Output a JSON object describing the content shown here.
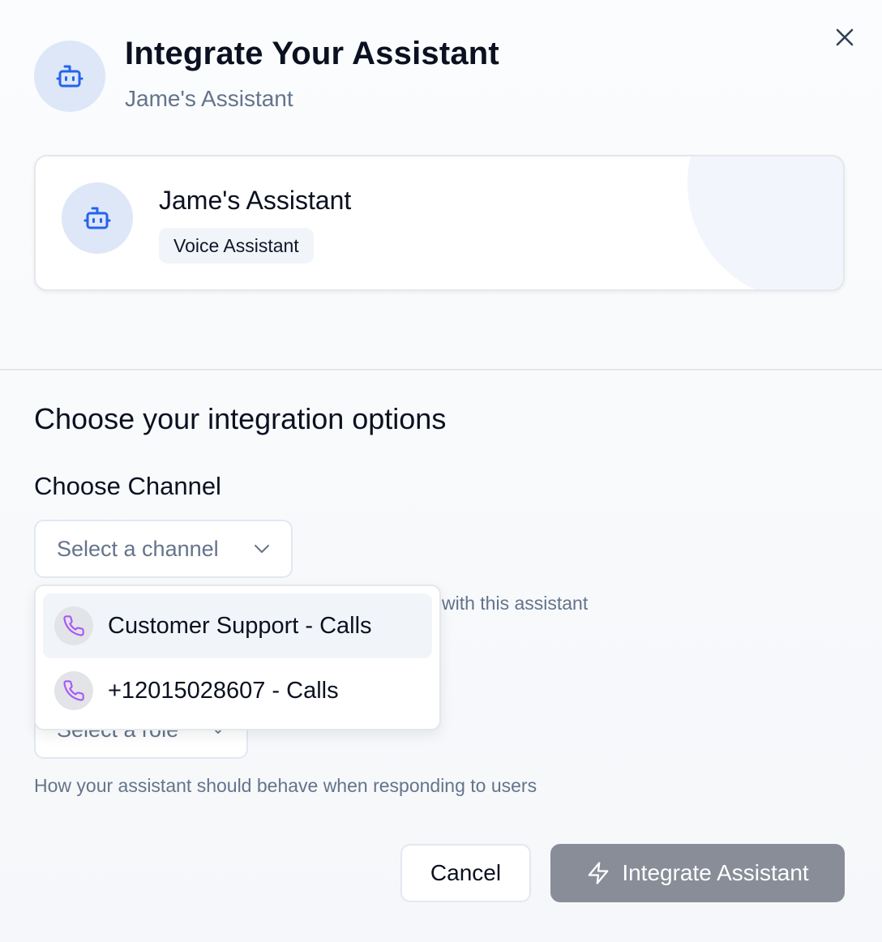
{
  "header": {
    "title": "Integrate Your Assistant",
    "subtitle": "Jame's Assistant",
    "icon": "bot-icon",
    "close_icon": "close-icon"
  },
  "assistant_card": {
    "name": "Jame's Assistant",
    "badge": "Voice Assistant",
    "icon": "bot-icon"
  },
  "section": {
    "title": "Choose your integration options"
  },
  "channel": {
    "label": "Choose Channel",
    "placeholder": "Select a channel",
    "helper_visible": "with this assistant",
    "options": [
      {
        "label": "Customer Support - Calls",
        "icon": "phone-icon",
        "highlighted": true
      },
      {
        "label": "+12015028607 - Calls",
        "icon": "phone-icon",
        "highlighted": false
      }
    ]
  },
  "role": {
    "placeholder_visible": "Select a role",
    "helper": "How your assistant should behave when responding to users"
  },
  "actions": {
    "cancel": "Cancel",
    "integrate": "Integrate Assistant",
    "integrate_icon": "lightning-icon"
  },
  "colors": {
    "accent": "#2563eb",
    "phone_icon": "#a855f7",
    "avatar_bg": "#dde7f7",
    "integrate_btn_bg": "#888d98"
  }
}
